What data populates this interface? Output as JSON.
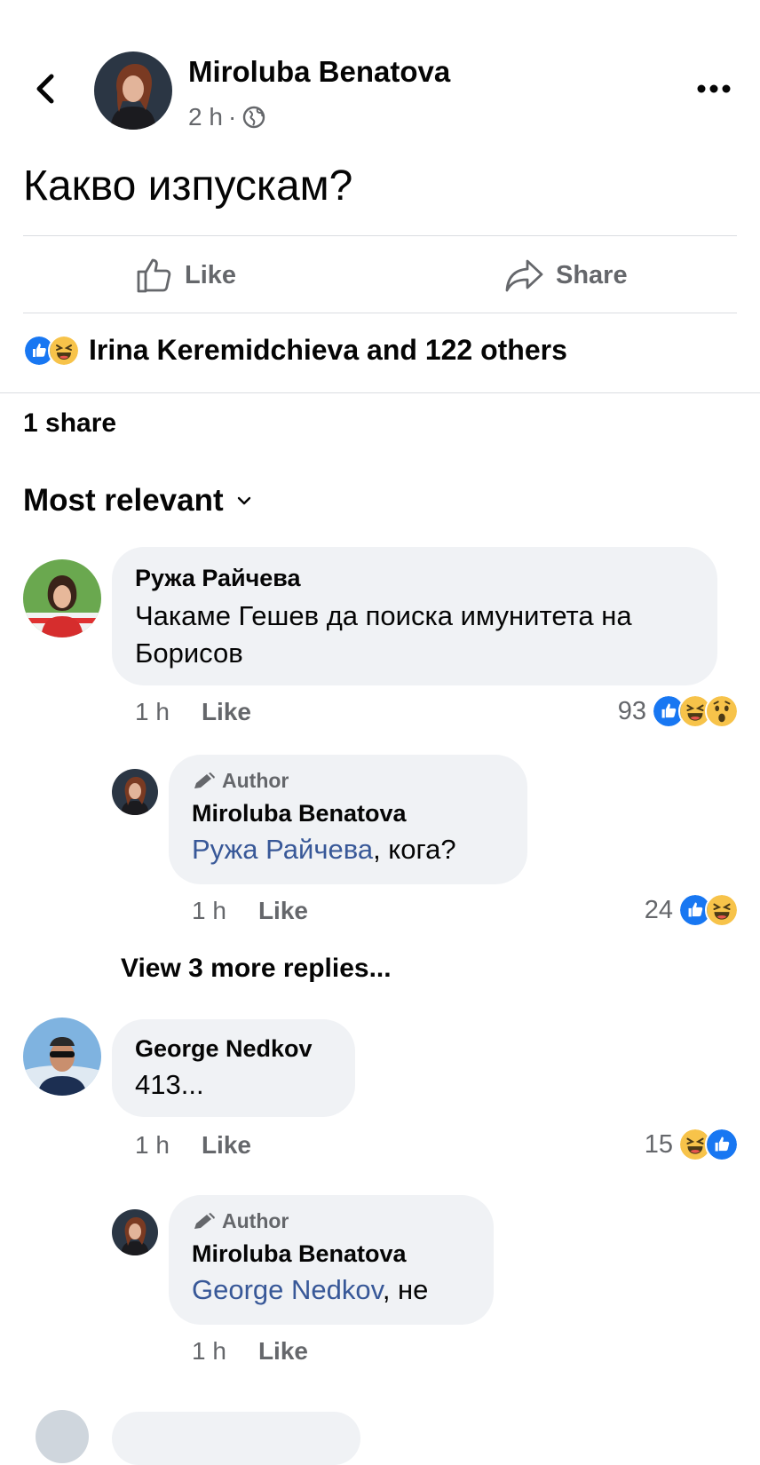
{
  "header": {
    "author": "Miroluba Benatova",
    "time": "2 h",
    "separator": "·"
  },
  "post": {
    "text": "Какво изпускам?"
  },
  "actions": {
    "like_label": "Like",
    "share_label": "Share"
  },
  "reactions": {
    "summary": "Irina Keremidchieva and 122 others"
  },
  "shares": {
    "text": "1 share"
  },
  "sort": {
    "label": "Most relevant"
  },
  "comments": [
    {
      "name": "Ружа Райчева",
      "text": "Чакаме Гешев да поиска имунитета на Борисов",
      "time": "1 h",
      "like_label": "Like",
      "reaction_count": "93",
      "reply": {
        "badge": "Author",
        "name": "Miroluba Benatova",
        "mention": "Ружа Райчева",
        "text": ", кога?",
        "time": "1 h",
        "like_label": "Like",
        "reaction_count": "24"
      }
    },
    {
      "name": "George Nedkov",
      "text": "413...",
      "time": "1 h",
      "like_label": "Like",
      "reaction_count": "15",
      "reply": {
        "badge": "Author",
        "name": "Miroluba Benatova",
        "mention": "George Nedkov",
        "text": ", не",
        "time": "1 h",
        "like_label": "Like"
      }
    }
  ],
  "view_more": {
    "label": "View 3 more replies..."
  },
  "colors": {
    "like_blue": "#1877f2",
    "haha_yellow": "#f7c34a",
    "mention_blue": "#385898",
    "bubble_gray": "#f0f2f5",
    "meta_gray": "#65676b"
  },
  "icons": [
    "back-icon",
    "globe-icon",
    "more-icon",
    "like-thumb-icon",
    "share-arrow-icon",
    "like-reaction-icon",
    "haha-reaction-icon",
    "wow-reaction-icon",
    "chevron-down-icon",
    "pencil-icon"
  ]
}
